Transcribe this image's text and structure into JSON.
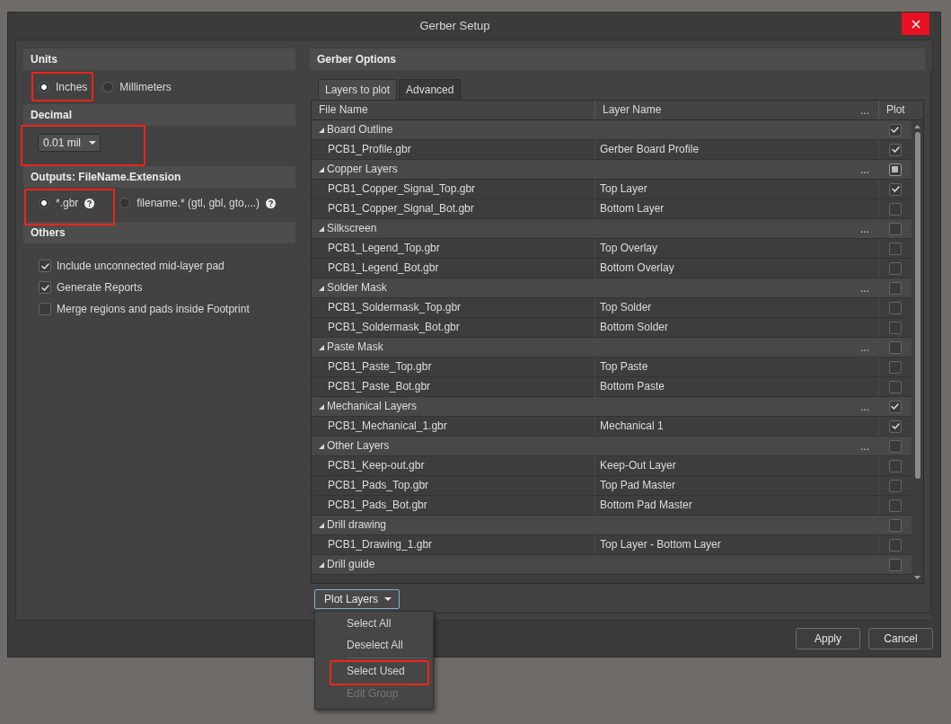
{
  "window": {
    "title": "Gerber Setup"
  },
  "units": {
    "title": "Units",
    "options": [
      {
        "label": "Inches",
        "selected": true,
        "highlighted": true
      },
      {
        "label": "Millimeters",
        "selected": false,
        "highlighted": false
      }
    ]
  },
  "decimal": {
    "title": "Decimal",
    "value": "0.01 mil",
    "highlighted": true
  },
  "outputs": {
    "title": "Outputs: FileName.Extension",
    "options": [
      {
        "label": "*.gbr",
        "selected": true,
        "highlighted": true
      },
      {
        "label": "filename.* (gtl, gbl, gto,...)",
        "selected": false,
        "highlighted": false
      }
    ]
  },
  "others": {
    "title": "Others",
    "options": [
      {
        "label": "Include unconnected mid-layer pad",
        "checked": true
      },
      {
        "label": "Generate Reports",
        "checked": true
      },
      {
        "label": "Merge regions and pads inside Footprint",
        "checked": false
      }
    ]
  },
  "gerber_options": {
    "title": "Gerber Options",
    "tabs": [
      {
        "label": "Layers to plot",
        "selected": true
      },
      {
        "label": "Advanced",
        "selected": false
      }
    ],
    "table": {
      "columns": [
        {
          "label": "File Name"
        },
        {
          "label": "Layer Name",
          "menu": "..."
        },
        {
          "label": "Plot"
        }
      ],
      "groups": [
        {
          "name": "Board Outline",
          "expanded": true,
          "checked": true,
          "partial": false,
          "children": [
            {
              "file": "PCB1_Profile.gbr",
              "layer": "Gerber Board Profile",
              "checked": true
            }
          ]
        },
        {
          "name": "Copper Layers",
          "expanded": true,
          "menu": "...",
          "checked": false,
          "partial": true,
          "children": [
            {
              "file": "PCB1_Copper_Signal_Top.gbr",
              "layer": "Top Layer",
              "checked": true
            },
            {
              "file": "PCB1_Copper_Signal_Bot.gbr",
              "layer": "Bottom Layer",
              "checked": false
            }
          ]
        },
        {
          "name": "Silkscreen",
          "expanded": true,
          "menu": "...",
          "checked": false,
          "partial": false,
          "children": [
            {
              "file": "PCB1_Legend_Top.gbr",
              "layer": "Top Overlay",
              "checked": false
            },
            {
              "file": "PCB1_Legend_Bot.gbr",
              "layer": "Bottom Overlay",
              "checked": false
            }
          ]
        },
        {
          "name": "Solder Mask",
          "expanded": true,
          "menu": "...",
          "checked": false,
          "partial": false,
          "children": [
            {
              "file": "PCB1_Soldermask_Top.gbr",
              "layer": "Top Solder",
              "checked": false
            },
            {
              "file": "PCB1_Soldermask_Bot.gbr",
              "layer": "Bottom Solder",
              "checked": false
            }
          ]
        },
        {
          "name": "Paste Mask",
          "expanded": true,
          "menu": "...",
          "checked": false,
          "partial": false,
          "children": [
            {
              "file": "PCB1_Paste_Top.gbr",
              "layer": "Top Paste",
              "checked": false
            },
            {
              "file": "PCB1_Paste_Bot.gbr",
              "layer": "Bottom Paste",
              "checked": false
            }
          ]
        },
        {
          "name": "Mechanical Layers",
          "expanded": true,
          "menu": "...",
          "checked": true,
          "partial": false,
          "children": [
            {
              "file": "PCB1_Mechanical_1.gbr",
              "layer": "Mechanical 1",
              "checked": true
            }
          ]
        },
        {
          "name": "Other Layers",
          "expanded": true,
          "menu": "...",
          "checked": false,
          "partial": false,
          "children": [
            {
              "file": "PCB1_Keep-out.gbr",
              "layer": "Keep-Out Layer",
              "checked": false
            },
            {
              "file": "PCB1_Pads_Top.gbr",
              "layer": "Top Pad Master",
              "checked": false
            },
            {
              "file": "PCB1_Pads_Bot.gbr",
              "layer": "Bottom Pad Master",
              "checked": false
            }
          ]
        },
        {
          "name": "Drill drawing",
          "expanded": true,
          "checked": false,
          "partial": false,
          "children": [
            {
              "file": "PCB1_Drawing_1.gbr",
              "layer": "Top Layer - Bottom Layer",
              "checked": false
            }
          ]
        },
        {
          "name": "Drill guide",
          "expanded": true,
          "checked": false,
          "partial": false
        }
      ]
    },
    "plot_menu": {
      "button": "Plot Layers",
      "open": true,
      "items": [
        {
          "label": "Select All",
          "disabled": false,
          "divider_before": false,
          "highlighted": false
        },
        {
          "label": "Deselect All",
          "disabled": false,
          "divider_before": false,
          "highlighted": false
        },
        {
          "label": "Select Used",
          "disabled": false,
          "divider_before": true,
          "highlighted": true
        },
        {
          "label": "Edit Group",
          "disabled": true,
          "divider_before": false,
          "highlighted": false
        }
      ]
    }
  },
  "buttons": [
    {
      "label": "Apply"
    },
    {
      "label": "Cancel"
    }
  ]
}
